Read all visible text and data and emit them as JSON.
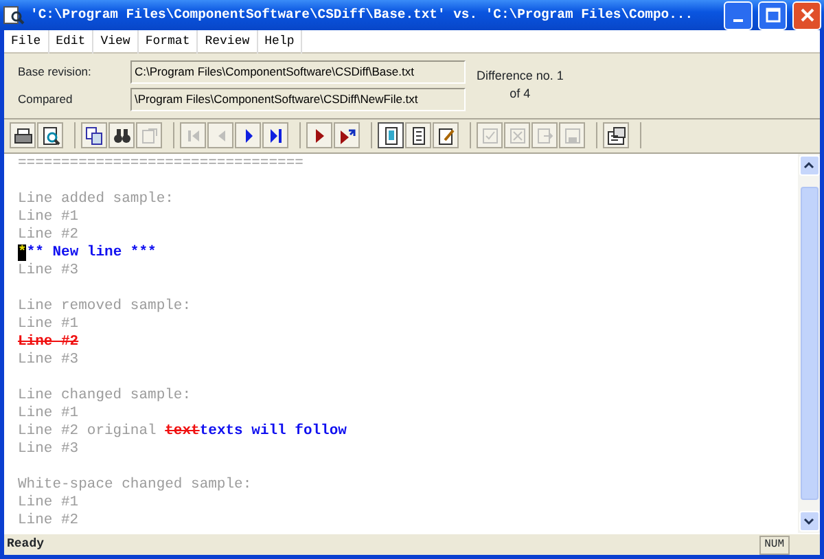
{
  "window": {
    "title": "'C:\\Program Files\\ComponentSoftware\\CSDiff\\Base.txt' vs. 'C:\\Program Files\\Compo..."
  },
  "menu": [
    "File",
    "Edit",
    "View",
    "Format",
    "Review",
    "Help"
  ],
  "info": {
    "base_label": "Base revision:",
    "base_value": "C:\\Program Files\\ComponentSoftware\\CSDiff\\Base.txt",
    "compared_label": "Compared",
    "compared_value": "\\Program Files\\ComponentSoftware\\CSDiff\\NewFile.txt",
    "difference": "Difference no. 1",
    "of": "of 4"
  },
  "toolbar": [
    [
      {
        "kind": "print",
        "disabled": false,
        "selected": false
      },
      {
        "kind": "preview",
        "disabled": false,
        "selected": false
      }
    ],
    [
      {
        "kind": "copy",
        "disabled": false,
        "selected": false
      },
      {
        "kind": "find",
        "disabled": false,
        "selected": false
      },
      {
        "kind": "goto",
        "disabled": true,
        "selected": false
      }
    ],
    [
      {
        "kind": "first",
        "disabled": true,
        "selected": false
      },
      {
        "kind": "prev",
        "disabled": true,
        "selected": false
      },
      {
        "kind": "next",
        "disabled": false,
        "selected": false
      },
      {
        "kind": "last",
        "disabled": false,
        "selected": false
      }
    ],
    [
      {
        "kind": "nextdiff",
        "disabled": false,
        "selected": false
      },
      {
        "kind": "nextdiffjump",
        "disabled": false,
        "selected": false
      }
    ],
    [
      {
        "kind": "viewpage",
        "disabled": false,
        "selected": true
      },
      {
        "kind": "viewlist",
        "disabled": false,
        "selected": false
      },
      {
        "kind": "viewedit",
        "disabled": false,
        "selected": false
      }
    ],
    [
      {
        "kind": "accept",
        "disabled": true,
        "selected": false
      },
      {
        "kind": "reject",
        "disabled": true,
        "selected": false
      },
      {
        "kind": "export",
        "disabled": true,
        "selected": false
      },
      {
        "kind": "save",
        "disabled": true,
        "selected": false
      }
    ],
    [
      {
        "kind": "options",
        "disabled": false,
        "selected": false
      }
    ]
  ],
  "lines": [
    {
      "kind": "text",
      "segments": [
        {
          "kind": "plain",
          "text": "================================="
        }
      ]
    },
    {
      "kind": "blank"
    },
    {
      "kind": "text",
      "segments": [
        {
          "kind": "plain",
          "text": "Line added sample:"
        }
      ]
    },
    {
      "kind": "text",
      "segments": [
        {
          "kind": "plain",
          "text": "Line #1"
        }
      ]
    },
    {
      "kind": "text",
      "segments": [
        {
          "kind": "plain",
          "text": "Line #2"
        }
      ]
    },
    {
      "kind": "text",
      "segments": [
        {
          "kind": "cursor",
          "text": "*"
        },
        {
          "kind": "added",
          "text": "** New line ***"
        }
      ]
    },
    {
      "kind": "text",
      "segments": [
        {
          "kind": "plain",
          "text": "Line #3"
        }
      ]
    },
    {
      "kind": "blank"
    },
    {
      "kind": "text",
      "segments": [
        {
          "kind": "plain",
          "text": "Line removed sample:"
        }
      ]
    },
    {
      "kind": "text",
      "segments": [
        {
          "kind": "plain",
          "text": "Line #1"
        }
      ]
    },
    {
      "kind": "text",
      "segments": [
        {
          "kind": "removed",
          "text": "Line #2"
        }
      ]
    },
    {
      "kind": "text",
      "segments": [
        {
          "kind": "plain",
          "text": "Line #3"
        }
      ]
    },
    {
      "kind": "blank"
    },
    {
      "kind": "text",
      "segments": [
        {
          "kind": "plain",
          "text": "Line changed sample:"
        }
      ]
    },
    {
      "kind": "text",
      "segments": [
        {
          "kind": "plain",
          "text": "Line #1"
        }
      ]
    },
    {
      "kind": "text",
      "segments": [
        {
          "kind": "plain",
          "text": "Line #2 original "
        },
        {
          "kind": "removed",
          "text": "text"
        },
        {
          "kind": "added",
          "text": "texts will follow"
        }
      ]
    },
    {
      "kind": "text",
      "segments": [
        {
          "kind": "plain",
          "text": "Line #3"
        }
      ]
    },
    {
      "kind": "blank"
    },
    {
      "kind": "text",
      "segments": [
        {
          "kind": "plain",
          "text": "White-space changed sample:"
        }
      ]
    },
    {
      "kind": "text",
      "segments": [
        {
          "kind": "plain",
          "text": "Line #1"
        }
      ]
    },
    {
      "kind": "text",
      "segments": [
        {
          "kind": "plain",
          "text": "Line #2"
        }
      ]
    }
  ],
  "status_bar": {
    "message": "Ready",
    "indicator": "NUM"
  }
}
